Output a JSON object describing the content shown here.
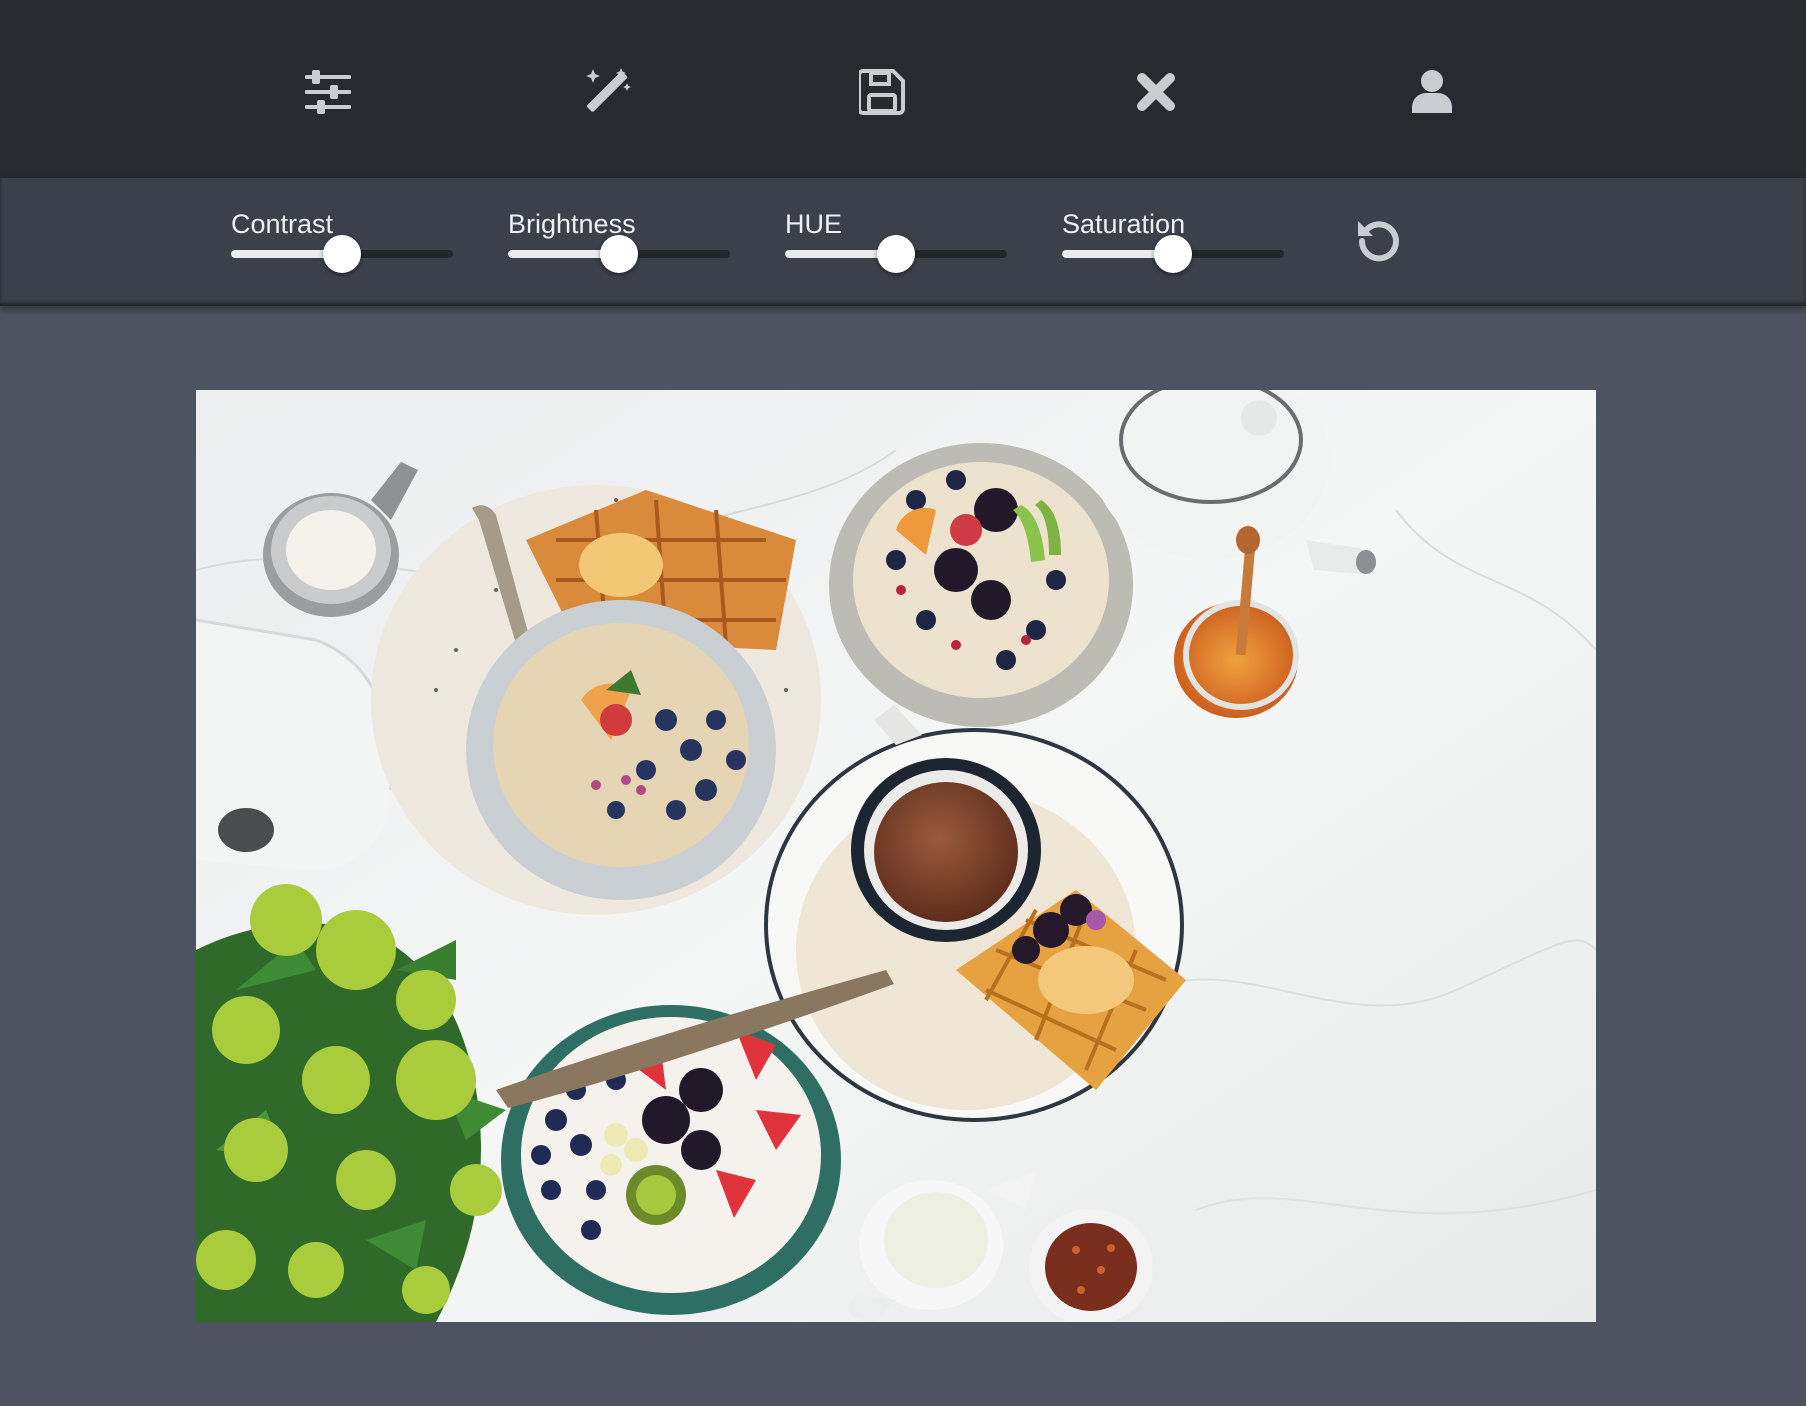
{
  "toolbar": {
    "buttons": [
      {
        "icon": "sliders-icon"
      },
      {
        "icon": "magic-wand-icon"
      },
      {
        "icon": "floppy-disk-icon"
      },
      {
        "icon": "close-icon"
      },
      {
        "icon": "user-icon"
      }
    ]
  },
  "adjustments": {
    "sliders": [
      {
        "label": "Contrast",
        "value": 0.5
      },
      {
        "label": "Brightness",
        "value": 0.5
      },
      {
        "label": "HUE",
        "value": 0.5
      },
      {
        "label": "Saturation",
        "value": 0.5
      }
    ],
    "reset_icon": "reset-icon"
  },
  "photo": {
    "subject": "breakfast-flatlay"
  },
  "colors": {
    "toolbar_bg": "#272a31",
    "adjust_bar_bg": "#3b404b",
    "workspace_bg": "#4d5360",
    "icon_color": "#c9ccd1"
  }
}
